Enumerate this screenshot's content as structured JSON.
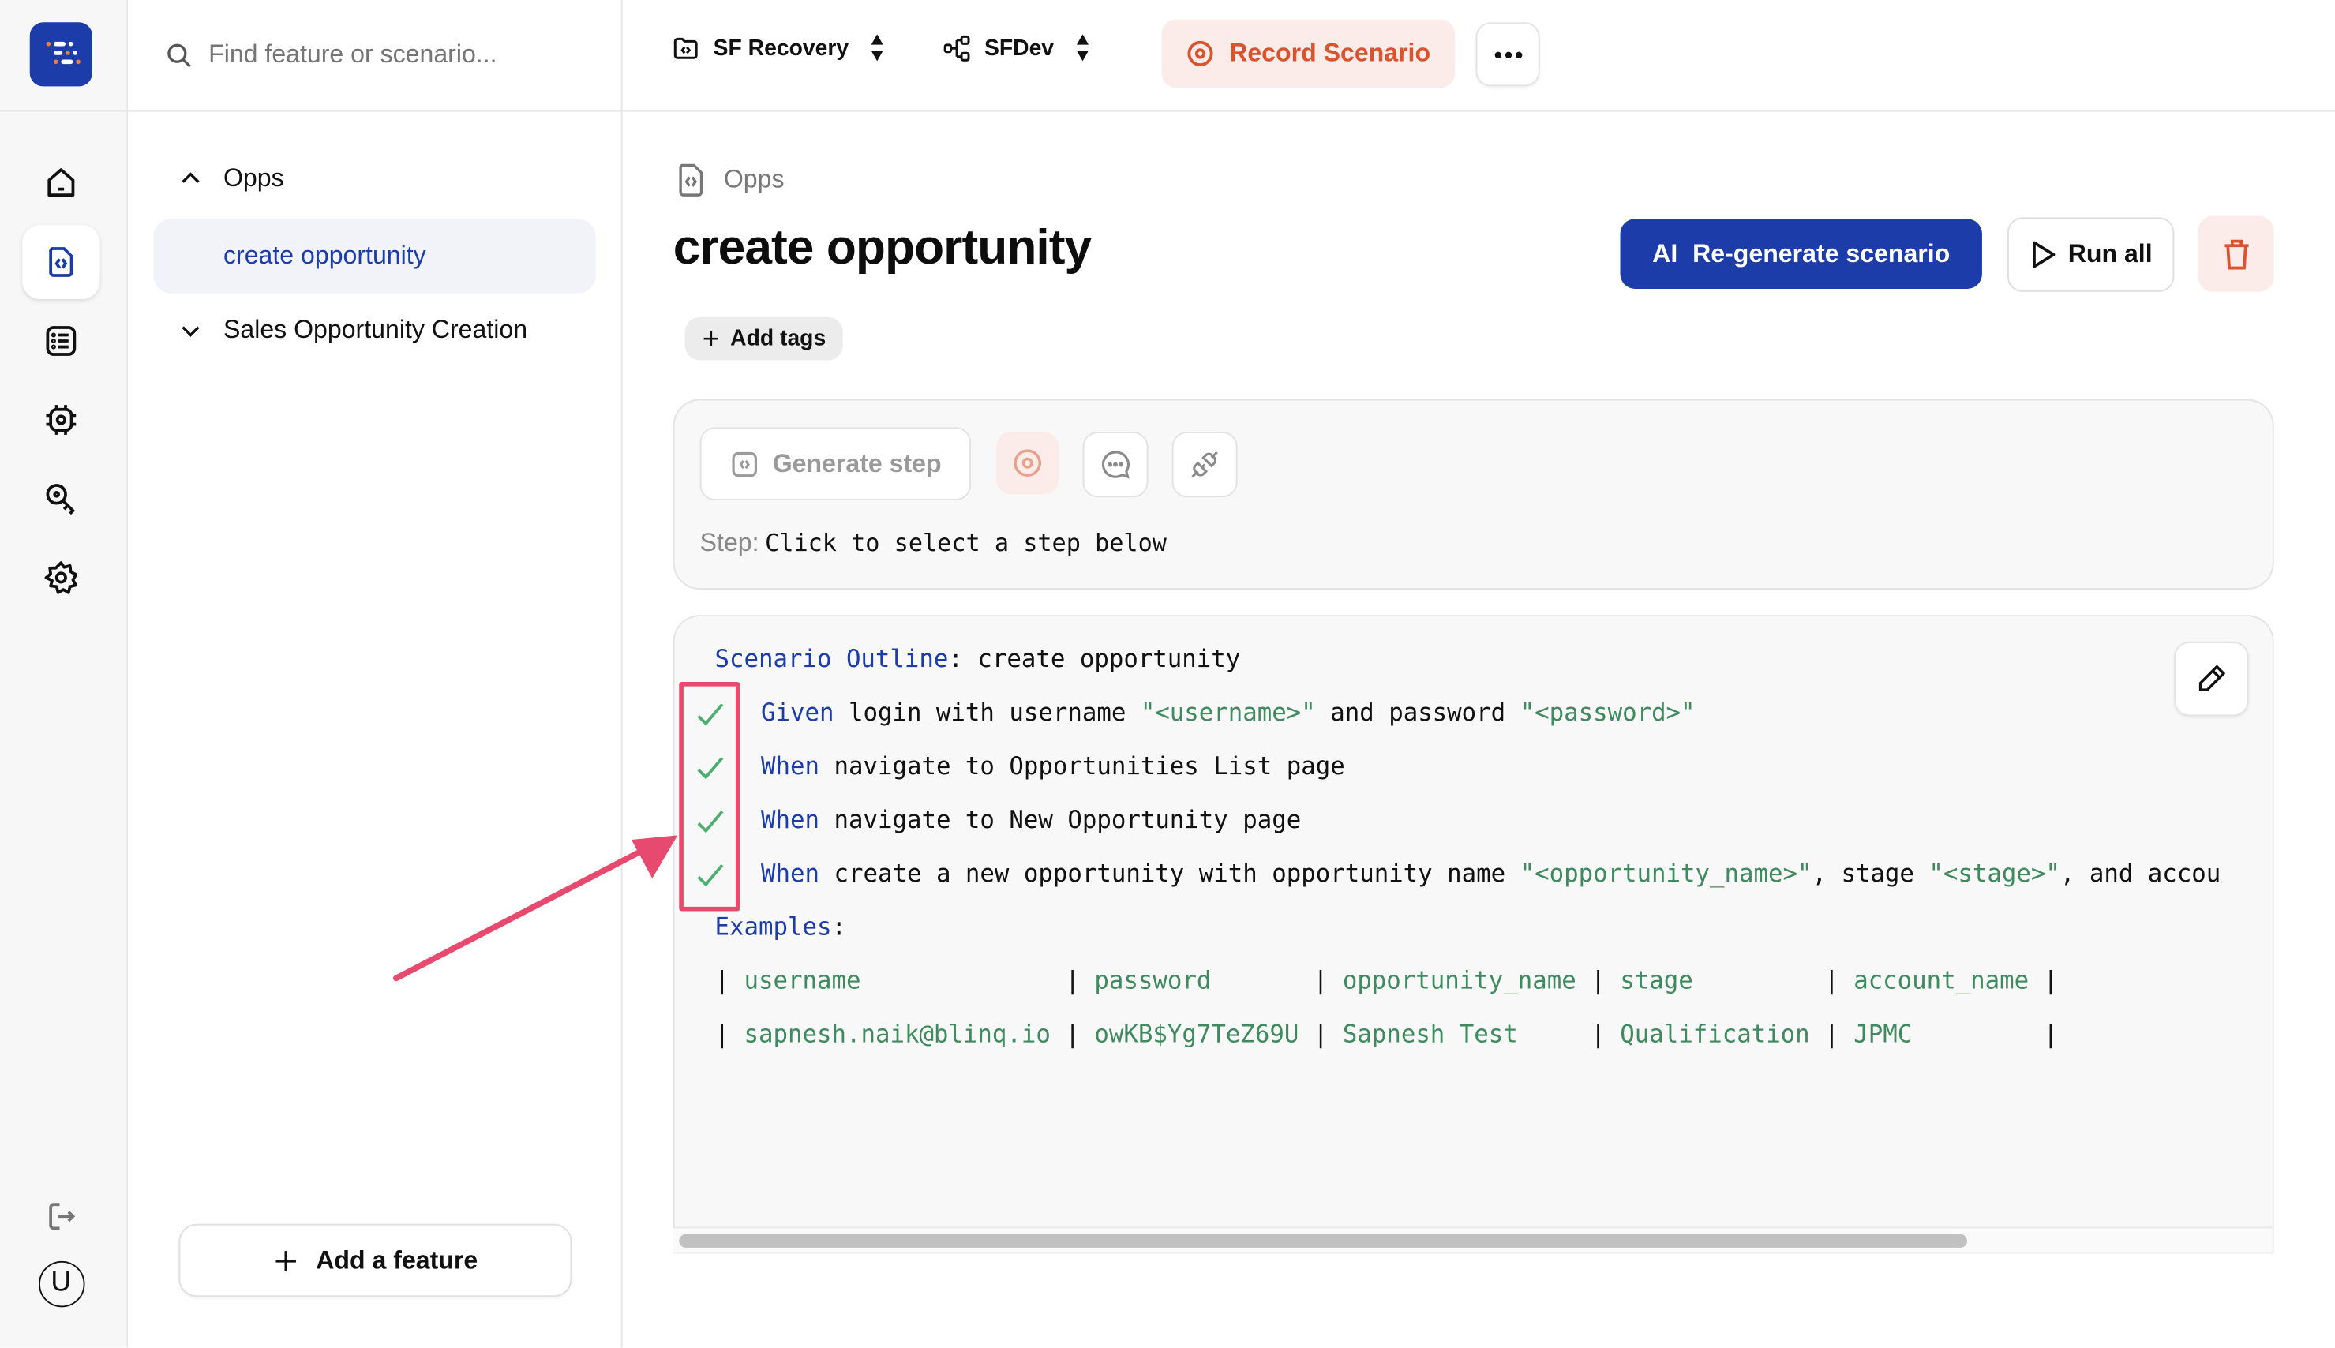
{
  "app": {
    "brand_colors": {
      "primary": "#1c3caa",
      "record": "#d9532f",
      "record_bg": "#fbece9",
      "gherkin_keyword": "#1c3caa",
      "gherkin_string": "#3f8a5e",
      "pass_check": "#4caf6f",
      "annotation": "#e84a6f"
    }
  },
  "rail": {
    "items": [
      {
        "name": "home",
        "icon": "home-icon",
        "active": false
      },
      {
        "name": "features",
        "icon": "file-code-icon",
        "active": true
      },
      {
        "name": "list",
        "icon": "list-icon",
        "active": false
      },
      {
        "name": "integrations",
        "icon": "chip-icon",
        "active": false
      },
      {
        "name": "keys",
        "icon": "key-icon",
        "active": false
      },
      {
        "name": "settings",
        "icon": "gear-icon",
        "active": false
      }
    ],
    "logout_icon": "logout-icon",
    "avatar_letter": "U"
  },
  "panel": {
    "search_placeholder": "Find feature or scenario...",
    "tree": [
      {
        "label": "Opps",
        "expanded": true,
        "children": [
          {
            "label": "create opportunity",
            "selected": true
          }
        ]
      },
      {
        "label": "Sales Opportunity Creation",
        "expanded": false,
        "children": []
      }
    ],
    "add_feature_label": "Add a feature"
  },
  "topbar": {
    "project_selector": "SF Recovery",
    "env_selector": "SFDev",
    "record_label": "Record Scenario",
    "more_label": "More options"
  },
  "main": {
    "breadcrumb": "Opps",
    "title": "create opportunity",
    "regen_ai": "AI",
    "regen_label": "Re-generate scenario",
    "run_all_label": "Run all",
    "add_tags_label": "Add tags",
    "step_panel": {
      "generate_step_label": "Generate step",
      "step_label": "Step:",
      "step_value": "Click to select a step below"
    },
    "scenario": {
      "outline_keyword": "Scenario Outline",
      "outline_title": "create opportunity",
      "steps": [
        {
          "keyword": "Given",
          "status": "passed",
          "parts": [
            {
              "t": "login with username ",
              "s": false
            },
            {
              "t": "\"<username>\"",
              "s": true
            },
            {
              "t": " and password ",
              "s": false
            },
            {
              "t": "\"<password>\"",
              "s": true
            }
          ]
        },
        {
          "keyword": "When",
          "status": "passed",
          "parts": [
            {
              "t": "navigate to Opportunities List page",
              "s": false
            }
          ]
        },
        {
          "keyword": "When",
          "status": "passed",
          "parts": [
            {
              "t": "navigate to New Opportunity page",
              "s": false
            }
          ]
        },
        {
          "keyword": "When",
          "status": "passed",
          "parts": [
            {
              "t": "create a new opportunity with opportunity name ",
              "s": false
            },
            {
              "t": "\"<opportunity_name>\"",
              "s": true
            },
            {
              "t": ", stage ",
              "s": false
            },
            {
              "t": "\"<stage>\"",
              "s": true
            },
            {
              "t": ", and accou",
              "s": false
            }
          ]
        }
      ],
      "examples_keyword": "Examples",
      "examples_table": {
        "headers": [
          "username",
          "password",
          "opportunity_name",
          "stage",
          "account_name"
        ],
        "rows": [
          [
            "sapnesh.naik@blinq.io",
            "owKB$Yg7TeZ69U",
            "Sapnesh Test",
            "Qualification",
            "JPMC"
          ]
        ]
      }
    }
  }
}
